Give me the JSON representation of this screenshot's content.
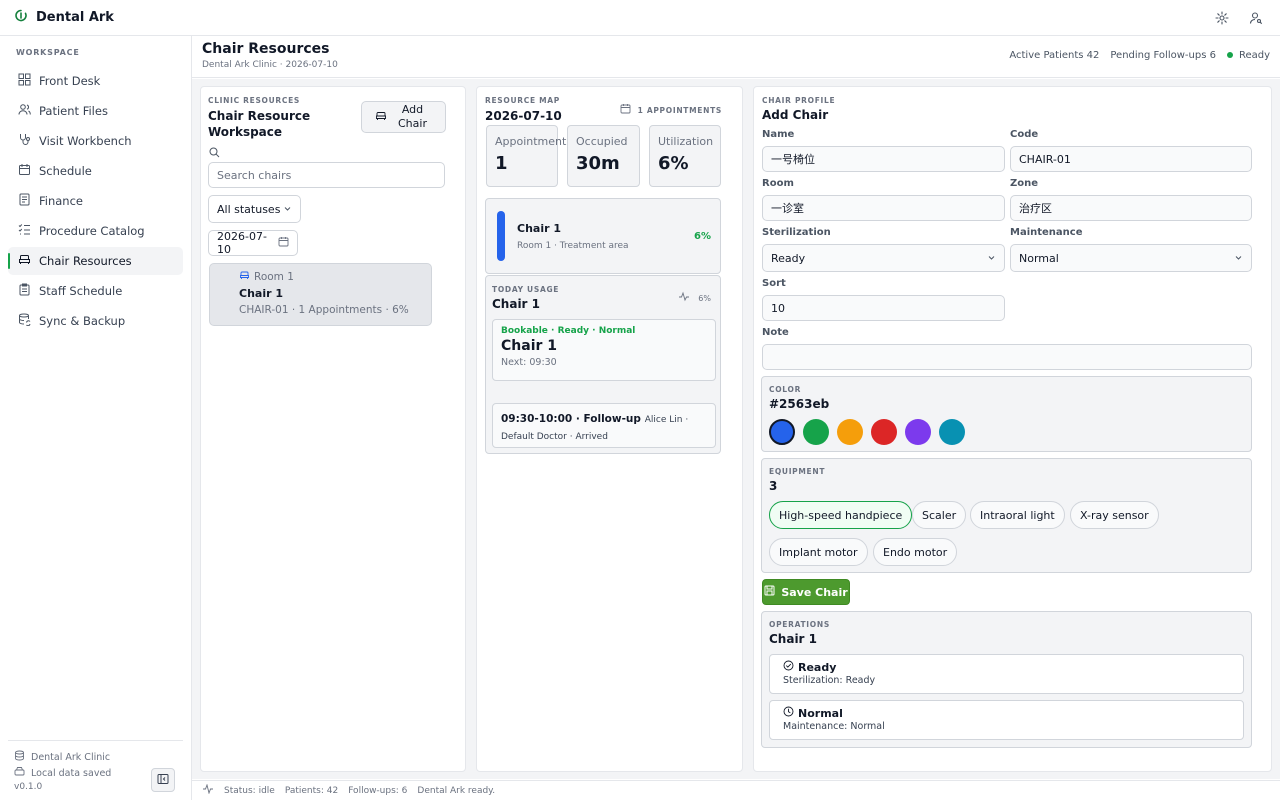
{
  "app": {
    "title": "Dental Ark"
  },
  "topbar": {
    "settings_icon": "gear-icon",
    "account_icon": "user-key-icon"
  },
  "sidebar": {
    "heading": "WORKSPACE",
    "items": [
      {
        "label": "Front Desk",
        "icon": "grid-icon",
        "active": false
      },
      {
        "label": "Patient Files",
        "icon": "users-icon",
        "active": false
      },
      {
        "label": "Visit Workbench",
        "icon": "stethoscope-icon",
        "active": false
      },
      {
        "label": "Schedule",
        "icon": "calendar-icon",
        "active": false
      },
      {
        "label": "Finance",
        "icon": "document-icon",
        "active": false
      },
      {
        "label": "Procedure Catalog",
        "icon": "checklist-icon",
        "active": false
      },
      {
        "label": "Chair Resources",
        "icon": "chair-icon",
        "active": true
      },
      {
        "label": "Staff Schedule",
        "icon": "clipboard-icon",
        "active": false
      },
      {
        "label": "Sync & Backup",
        "icon": "database-sync-icon",
        "active": false
      }
    ],
    "footer": {
      "clinic": "Dental Ark Clinic",
      "storage": "Local data saved",
      "version": "v0.1.0"
    }
  },
  "header": {
    "title": "Chair Resources",
    "subtitle": "Dental Ark Clinic · 2026-07-10",
    "active_patients": "Active Patients 42",
    "pending_followups": "Pending Follow-ups 6",
    "status": "Ready"
  },
  "left_panel": {
    "eyebrow": "CLINIC RESOURCES",
    "title": "Chair Resource Workspace",
    "add_button": "Add Chair",
    "search_placeholder": "Search chairs",
    "status_filter": "All statuses",
    "date": "2026-07-10",
    "chairs": [
      {
        "room": "Room 1",
        "name": "Chair 1",
        "meta": "CHAIR-01 · 1 Appointments · 6%"
      }
    ]
  },
  "middle_panel": {
    "eyebrow": "RESOURCE MAP",
    "date": "2026-07-10",
    "appointments_badge": "1 APPOINTMENTS",
    "stats": [
      {
        "label": "Appointments",
        "value": "1"
      },
      {
        "label": "Occupied",
        "value": "30m"
      },
      {
        "label": "Utilization",
        "value": "6%"
      }
    ],
    "map_chair": {
      "name": "Chair 1",
      "location": "Room 1 · Treatment area",
      "percent": "6%",
      "color": "#2563eb"
    },
    "usage": {
      "eyebrow": "TODAY USAGE",
      "title": "Chair 1",
      "percent": "6%",
      "status_line": "Bookable · Ready · Normal",
      "chair_name": "Chair 1",
      "next": "Next: 09:30",
      "appointment": {
        "time_type": "09:30-10:00 · Follow-up",
        "details": "Alice Lin · Default Doctor · Arrived"
      }
    }
  },
  "right_panel": {
    "eyebrow": "CHAIR PROFILE",
    "title": "Add Chair",
    "fields": {
      "name_label": "Name",
      "name_value": "一号椅位",
      "code_label": "Code",
      "code_value": "CHAIR-01",
      "room_label": "Room",
      "room_value": "一诊室",
      "zone_label": "Zone",
      "zone_value": "治疗区",
      "sterilization_label": "Sterilization",
      "sterilization_value": "Ready",
      "maintenance_label": "Maintenance",
      "maintenance_value": "Normal",
      "sort_label": "Sort",
      "sort_value": "10",
      "note_label": "Note",
      "note_value": ""
    },
    "color": {
      "eyebrow": "COLOR",
      "value": "#2563eb",
      "swatches": [
        "#2563eb",
        "#16a34a",
        "#f59e0b",
        "#dc2626",
        "#7c3aed",
        "#0891b2"
      ]
    },
    "equipment": {
      "eyebrow": "EQUIPMENT",
      "count": "3",
      "items": [
        {
          "label": "High-speed handpiece",
          "selected": true
        },
        {
          "label": "Scaler",
          "selected": false
        },
        {
          "label": "Intraoral light",
          "selected": false
        },
        {
          "label": "X-ray sensor",
          "selected": false
        },
        {
          "label": "Implant motor",
          "selected": false
        },
        {
          "label": "Endo motor",
          "selected": false
        }
      ]
    },
    "save_button": "Save Chair",
    "operations": {
      "eyebrow": "OPERATIONS",
      "title": "Chair 1",
      "cards": [
        {
          "title": "Ready",
          "detail": "Sterilization: Ready"
        },
        {
          "title": "Normal",
          "detail": "Maintenance: Normal"
        }
      ]
    }
  },
  "statusbar": {
    "status": "Status: idle",
    "patients": "Patients: 42",
    "followups": "Follow-ups: 6",
    "message": "Dental Ark ready."
  },
  "colors": {
    "accent": "#16a34a",
    "chair_color": "#2563eb",
    "percent_green": "#16a34a"
  }
}
